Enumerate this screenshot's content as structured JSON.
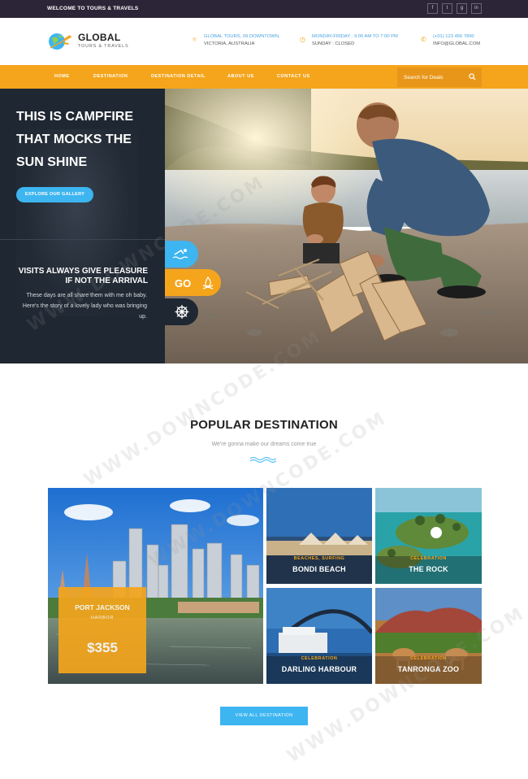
{
  "topbar": {
    "welcome": "WELCOME TO TOURS & TRAVELS",
    "social_icons": [
      "facebook-icon",
      "twitter-icon",
      "google-plus-icon",
      "linkedin-icon"
    ]
  },
  "header": {
    "logo_title": "GLOBAL",
    "logo_subtitle": "TOURS & TRAVELS",
    "address_line1": "GLOBAL TOURS, 09 DOWNTOWN,",
    "address_line2": "VICTORIA, AUSTRALIA",
    "hours_line1": "MONDAY-FRIDAY : 9:00 AM TO 7:00 PM",
    "hours_line2": "SUNDAY : CLOSED",
    "phone": "(+01) 123 456 7890",
    "email": "INFO@GLOBAL.COM"
  },
  "nav": {
    "items": [
      "HOME",
      "DESTINATION",
      "DESTINATION DETAIL",
      "ABOUT US",
      "CONTACT US"
    ],
    "search_placeholder": "Search for Deals"
  },
  "hero": {
    "title": "THIS IS CAMPFIRE THAT MOCKS THE SUN SHINE",
    "button": "EXPLORE OUR GALLERY",
    "subtitle": "VISITS ALWAYS GIVE PLEASURE IF NOT THE ARRIVAL",
    "text": "These days are all share them with me oh baby. Here's the story of a lovely lady who was bringing up.",
    "go_label": "GO"
  },
  "popular": {
    "title": "POPULAR DESTINATION",
    "subtitle": "We're gonna make our dreams come true",
    "featured": {
      "name": "PORT JACKSON",
      "sub": "HARBOR",
      "price": "$355"
    },
    "tiles": [
      {
        "tag": "BEACHES, SURFING",
        "name": "BONDI BEACH"
      },
      {
        "tag": "CELEBRATION",
        "name": "THE ROCK"
      },
      {
        "tag": "CELEBRATION",
        "name": "DARLING HARBOUR"
      },
      {
        "tag": "CELEBRATION",
        "name": "TANRONGA ZOO"
      }
    ],
    "view_all": "VIEW ALL DESTINATION"
  },
  "colors": {
    "accent_orange": "#f4a51c",
    "accent_blue": "#3db5f0",
    "dark": "#1f2732",
    "topbar": "#2c2538"
  },
  "watermark_text": "WWW.DOWNCODE.COM"
}
